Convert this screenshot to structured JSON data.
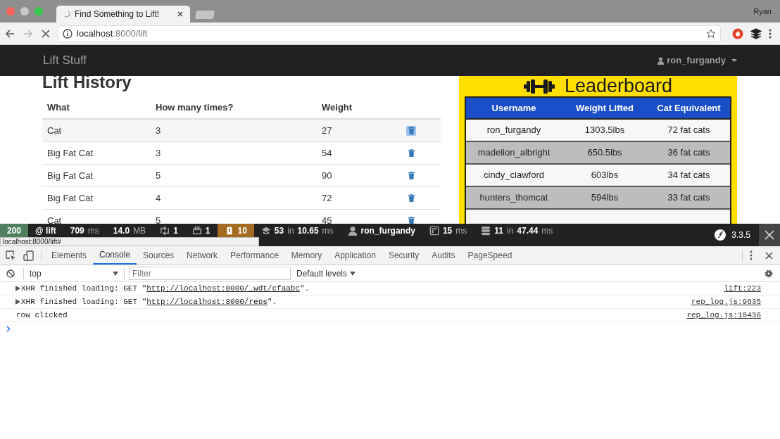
{
  "browser": {
    "tab_title": "Find Something to Lift!",
    "profile": "Ryan",
    "url_host": "localhost",
    "url_rest": ":8000/lift"
  },
  "navbar": {
    "brand": "Lift Stuff",
    "user": "ron_furgandy"
  },
  "lift_history": {
    "title": "Lift History",
    "columns": [
      "What",
      "How many times?",
      "Weight"
    ],
    "rows": [
      {
        "what": "Cat",
        "times": "3",
        "weight": "27",
        "selected": true
      },
      {
        "what": "Big Fat Cat",
        "times": "3",
        "weight": "54",
        "selected": false
      },
      {
        "what": "Big Fat Cat",
        "times": "5",
        "weight": "90",
        "selected": false
      },
      {
        "what": "Big Fat Cat",
        "times": "4",
        "weight": "72",
        "selected": false
      },
      {
        "what": "Cat",
        "times": "5",
        "weight": "45",
        "selected": false
      }
    ]
  },
  "leaderboard": {
    "title": "Leaderboard",
    "columns": [
      "Username",
      "Weight Lifted",
      "Cat Equivalent"
    ],
    "rows": [
      {
        "username": "ron_furgandy",
        "weight": "1303.5lbs",
        "cats": "72 fat cats"
      },
      {
        "username": "madelion_albright",
        "weight": "650.5lbs",
        "cats": "36 fat cats"
      },
      {
        "username": "cindy_clawford",
        "weight": "603lbs",
        "cats": "34 fat cats"
      },
      {
        "username": "hunters_thomcat",
        "weight": "594lbs",
        "cats": "33 fat cats"
      }
    ]
  },
  "debug_toolbar": {
    "items": [
      {
        "kind": "status",
        "parts": [
          {
            "text": "200",
            "muted": false
          }
        ]
      },
      {
        "kind": "route",
        "parts": [
          {
            "text": "@ lift",
            "muted": false
          }
        ]
      },
      {
        "kind": "time",
        "parts": [
          {
            "text": "709",
            "muted": false
          },
          {
            "text": "ms",
            "muted": true
          }
        ]
      },
      {
        "kind": "memory",
        "parts": [
          {
            "text": "14.0",
            "muted": false
          },
          {
            "text": "MB",
            "muted": true
          }
        ]
      },
      {
        "kind": "ajax",
        "parts": [
          {
            "text": "1",
            "muted": false
          }
        ]
      },
      {
        "kind": "forms",
        "parts": [
          {
            "text": "1",
            "muted": false
          }
        ]
      },
      {
        "kind": "warnings",
        "parts": [
          {
            "text": "10",
            "muted": false
          }
        ]
      },
      {
        "kind": "twig",
        "parts": [
          {
            "text": "53",
            "muted": false
          },
          {
            "text": "in",
            "muted": true
          },
          {
            "text": "10.65",
            "muted": false
          },
          {
            "text": "ms",
            "muted": true
          }
        ]
      },
      {
        "kind": "user",
        "parts": [
          {
            "text": "ron_furgandy",
            "muted": false
          }
        ]
      },
      {
        "kind": "render",
        "parts": [
          {
            "text": "15",
            "muted": false
          },
          {
            "text": "ms",
            "muted": true
          }
        ]
      },
      {
        "kind": "database",
        "parts": [
          {
            "text": "11",
            "muted": false
          },
          {
            "text": "in",
            "muted": true
          },
          {
            "text": "47.44",
            "muted": false
          },
          {
            "text": "ms",
            "muted": true
          }
        ]
      }
    ],
    "version": "3.3.5"
  },
  "status_tooltip": "localhost:8000/lift#",
  "devtools": {
    "tabs": [
      {
        "label": "Elements",
        "selected": false
      },
      {
        "label": "Console",
        "selected": true
      },
      {
        "label": "Sources",
        "selected": false
      },
      {
        "label": "Network",
        "selected": false
      },
      {
        "label": "Performance",
        "selected": false
      },
      {
        "label": "Memory",
        "selected": false
      },
      {
        "label": "Application",
        "selected": false
      },
      {
        "label": "Security",
        "selected": false
      },
      {
        "label": "Audits",
        "selected": false
      },
      {
        "label": "PageSpeed",
        "selected": false
      }
    ],
    "context": "top",
    "filter_placeholder": "Filter",
    "levels": "Default levels",
    "logs": [
      {
        "expandable": true,
        "prefix": "XHR finished loading: GET \"",
        "link": "http://localhost:8000/_wdt/cfaabc",
        "suffix": "\".",
        "source": "lift:223"
      },
      {
        "expandable": true,
        "prefix": "XHR finished loading: GET \"",
        "link": "http://localhost:8000/reps",
        "suffix": "\".",
        "source": "rep_log.js:9635"
      },
      {
        "expandable": false,
        "prefix": "row clicked",
        "source": "rep_log.js:10436"
      }
    ]
  }
}
